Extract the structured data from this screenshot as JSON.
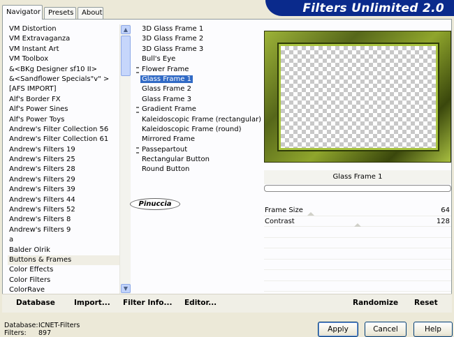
{
  "tabs": [
    {
      "label": "Navigator"
    },
    {
      "label": "Presets"
    },
    {
      "label": "About"
    }
  ],
  "app_title": "Filters Unlimited 2.0",
  "categories": [
    "VM Distortion",
    "VM Extravaganza",
    "VM Instant Art",
    "VM Toolbox",
    "&<BKg Designer sf10 II>",
    "&<Sandflower Specials\"v\" >",
    "[AFS IMPORT]",
    "Alf's Border FX",
    "Alf's Power Sines",
    "Alf's Power Toys",
    "Andrew's Filter Collection 56",
    "Andrew's Filter Collection 61",
    "Andrew's Filters 19",
    "Andrew's Filters 25",
    "Andrew's Filters 28",
    "Andrew's Filters 29",
    "Andrew's Filters 39",
    "Andrew's Filters 44",
    "Andrew's Filters 52",
    "Andrew's Filters 8",
    "Andrew's Filters 9",
    "a",
    "Balder Olrik",
    "Buttons & Frames",
    "Color Effects",
    "Color Filters",
    "ColorRave"
  ],
  "selected_category": "Buttons & Frames",
  "filters": [
    {
      "label": "3D Glass Frame 1",
      "group": false
    },
    {
      "label": "3D Glass Frame 2",
      "group": false
    },
    {
      "label": "3D Glass Frame 3",
      "group": false
    },
    {
      "label": "Bull's Eye",
      "group": false
    },
    {
      "label": "Flower Frame",
      "group": true
    },
    {
      "label": "Glass Frame 1",
      "group": false
    },
    {
      "label": "Glass Frame 2",
      "group": false
    },
    {
      "label": "Glass Frame 3",
      "group": false
    },
    {
      "label": "Gradient Frame",
      "group": true
    },
    {
      "label": "Kaleidoscopic Frame (rectangular)",
      "group": false
    },
    {
      "label": "Kaleidoscopic Frame (round)",
      "group": false
    },
    {
      "label": "Mirrored Frame",
      "group": false
    },
    {
      "label": "Passepartout",
      "group": true
    },
    {
      "label": "Rectangular Button",
      "group": false
    },
    {
      "label": "Round Button",
      "group": false
    }
  ],
  "selected_filter": "Glass Frame 1",
  "watermark": "Pinuccia",
  "filter_name": "Glass Frame 1",
  "params": [
    {
      "label": "Frame Size",
      "value": "64",
      "level": 0.25
    },
    {
      "label": "Contrast",
      "value": "128",
      "level": 0.5
    }
  ],
  "bottom_bar": {
    "database": "Database",
    "import": "Import...",
    "filter_info": "Filter Info...",
    "editor": "Editor...",
    "randomize": "Randomize",
    "reset": "Reset"
  },
  "status": {
    "db_label": "Database:",
    "db_value": "ICNET-Filters",
    "filters_label": "Filters:",
    "filters_value": "897"
  },
  "buttons": {
    "apply": "Apply",
    "cancel": "Cancel",
    "help": "Help"
  }
}
